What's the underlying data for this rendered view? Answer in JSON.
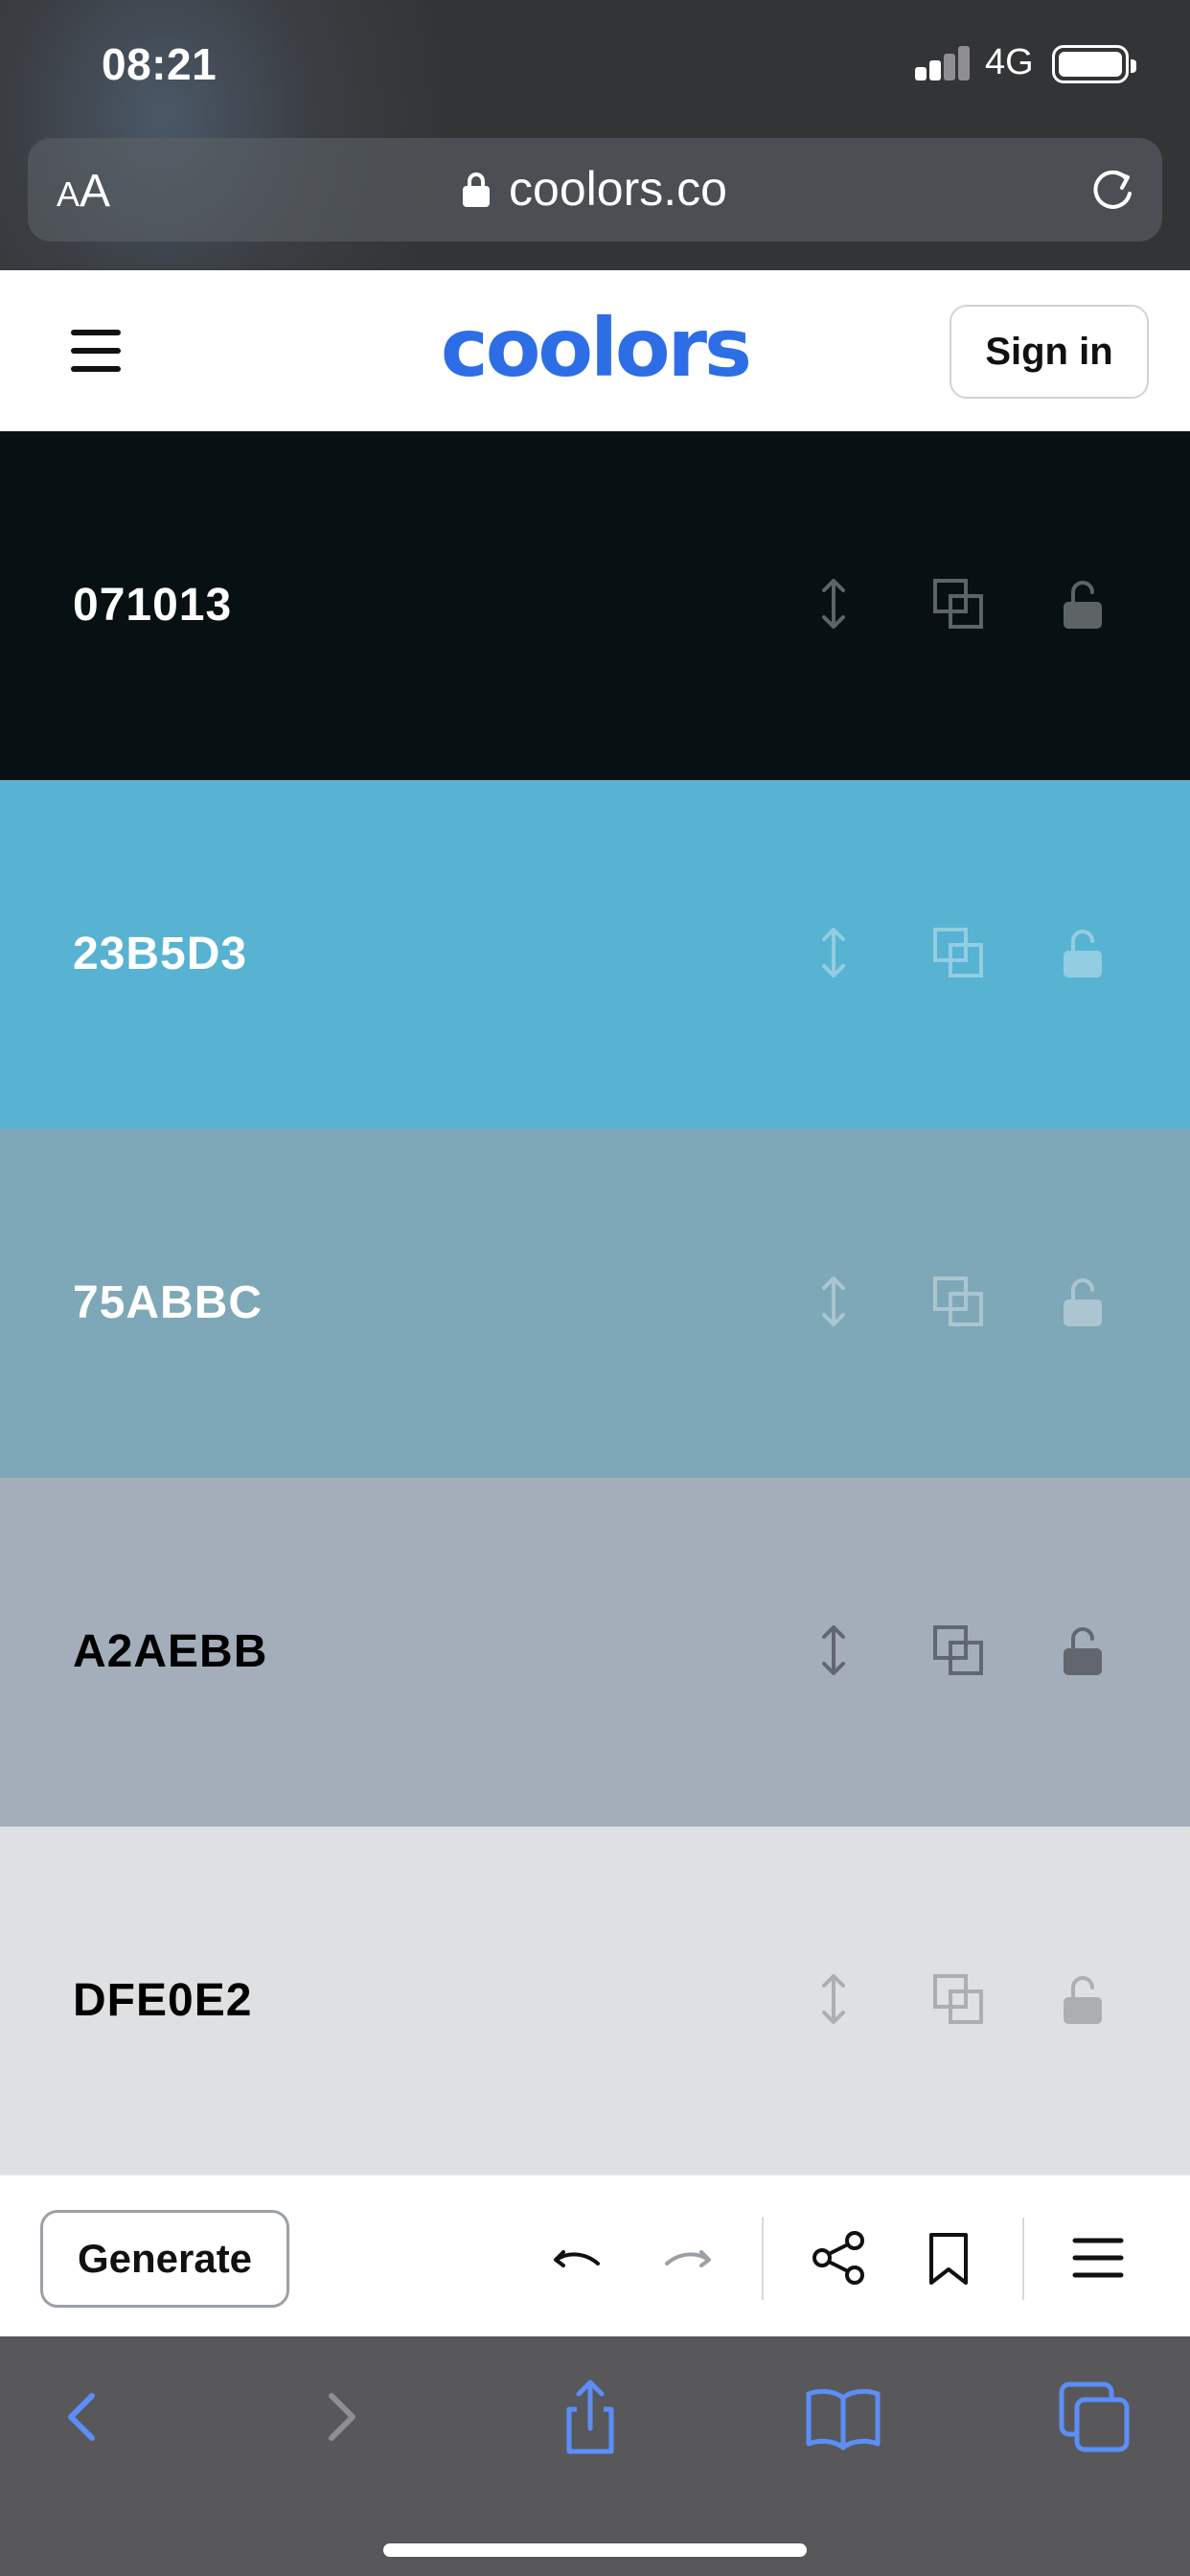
{
  "status_bar": {
    "time": "08:21",
    "network": "4G",
    "icons": [
      "signal-icon",
      "battery-icon"
    ]
  },
  "browser": {
    "text_size_small": "A",
    "text_size_big": "A",
    "url": "coolors.co",
    "icons": [
      "lock-icon",
      "reload-icon"
    ]
  },
  "header": {
    "logo_text": "coolors",
    "logo_color": "#2d6ee6",
    "sign_in_label": "Sign in",
    "icons": [
      "hamburger-menu-icon"
    ]
  },
  "palette": {
    "swatches": [
      {
        "hex": "071013",
        "color": "#071013",
        "text_color": "#ffffff",
        "icon_color": "#ffffff",
        "icon_opacity": 0.35
      },
      {
        "hex": "23B5D3",
        "color": "#57b3d1",
        "text_color": "#ffffff",
        "icon_color": "#ffffff",
        "icon_opacity": 0.35
      },
      {
        "hex": "75ABBC",
        "color": "#7ea8b8",
        "text_color": "#ffffff",
        "icon_color": "#ffffff",
        "icon_opacity": 0.35
      },
      {
        "hex": "A2AEBB",
        "color": "#a4aebb",
        "text_color": "#000000",
        "icon_color": "#000000",
        "icon_opacity": 0.4
      },
      {
        "hex": "DFE0E2",
        "color": "#dfe0e2",
        "text_color": "#000000",
        "icon_color": "#000000",
        "icon_opacity": 0.22
      }
    ],
    "swatch_icons": [
      "drag-icon",
      "copy-icon",
      "unlock-icon"
    ]
  },
  "toolbar": {
    "generate_label": "Generate",
    "icons": [
      "undo-icon",
      "redo-icon",
      "share-icon",
      "bookmark-icon",
      "menu-icon"
    ]
  },
  "safari_bar": {
    "icons": [
      "back-icon",
      "forward-icon",
      "share-sheet-icon",
      "bookmarks-icon",
      "tabs-icon"
    ],
    "accent_color": "#5b8ef7"
  }
}
